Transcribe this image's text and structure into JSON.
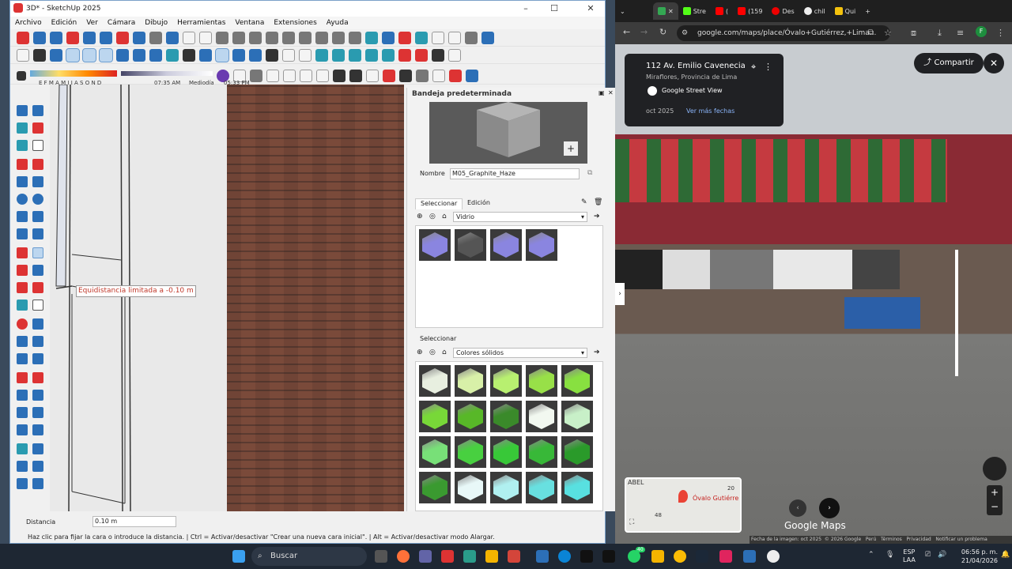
{
  "sketchup": {
    "title": "3D* - SketchUp 2025",
    "menu": [
      "Archivo",
      "Edición",
      "Ver",
      "Cámara",
      "Dibujo",
      "Herramientas",
      "Ventana",
      "Extensiones",
      "Ayuda"
    ],
    "shadow": {
      "months": "E F M A M J J A S O N D",
      "time_start": "07:35 AM",
      "mid": "Mediodía",
      "time_end": "05:33 PM"
    },
    "tooltip": "Equidistancia limitada a -0.10 m",
    "tray": {
      "title": "Bandeja predeterminada",
      "name_label": "Nombre",
      "name_value": "M05_Graphite_Haze",
      "tab_select": "Seleccionar",
      "tab_edit": "Edición",
      "collection1": "Vidrio",
      "select2": "Seleccionar",
      "collection2": "Colores sólidos"
    },
    "status_label": "Distancia",
    "distance_value": "0.10 m",
    "status_bar": "Haz clic para fijar la cara o introduce la distancia. | Ctrl = Activar/desactivar \"Crear una nueva cara inicial\". | Alt = Activar/desactivar modo Alargar.",
    "glass_colors": [
      "#8a85e0",
      "#555555",
      "#8a85e0",
      "#8a85e0"
    ],
    "solid_colors": [
      "#e8efe0",
      "#d8f0a8",
      "#b8f070",
      "#98e048",
      "#88e040",
      "#78d838",
      "#58b828",
      "#3a8a2a",
      "#f2f8f0",
      "#c8f0c8",
      "#78e078",
      "#48d040",
      "#38c838",
      "#38b838",
      "#2a9a2a",
      "#3a9a30",
      "#e8f8f8",
      "#b0f0f0",
      "#68e0e0",
      "#58e0e0"
    ]
  },
  "chrome": {
    "tabs": [
      "Stre",
      "(",
      "(159",
      "Des",
      "chil",
      "Qui"
    ],
    "url": "google.com/maps/place/Óvalo+Gutiérrez,+Lima...",
    "address_title": "112 Av. Emilio Cavenecia",
    "address_sub": "Miraflores, Provincia de Lima",
    "street_view": "Google Street View",
    "date": "oct 2025",
    "more_dates": "Ver más fechas",
    "share": "Compartir",
    "map_label": "Óvalo Gutiérre",
    "map_top": "ABEL",
    "map_num1": "20",
    "map_num2": "48",
    "brand": "Google Maps",
    "footer": [
      "Fecha de la imagen: oct 2025",
      "© 2026 Google",
      "Perú",
      "Términos",
      "Privacidad",
      "Notificar un problema"
    ]
  },
  "taskbar": {
    "search": "Buscar",
    "lang": "ESP",
    "lang2": "LAA",
    "time": "06:56 p. m.",
    "date": "21/04/2026",
    "badge": "40"
  }
}
